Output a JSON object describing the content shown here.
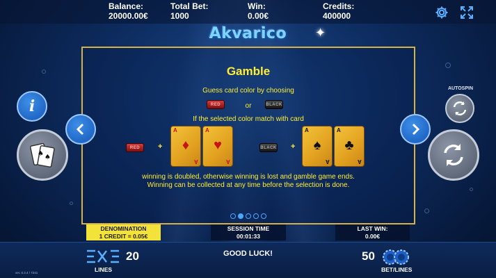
{
  "topbar": {
    "balance_label": "Balance:",
    "balance_value": "20000.00€",
    "total_bet_label": "Total Bet:",
    "total_bet_value": "1000",
    "win_label": "Win:",
    "win_value": "0.00€",
    "credits_label": "Credits:",
    "credits_value": "400000",
    "icons": [
      "gear-icon",
      "fullscreen-icon"
    ]
  },
  "logo": "Akvarico",
  "paytable": {
    "title": "Gamble",
    "instruction": "Guess card color by choosing",
    "or": "or",
    "match_text": "If the selected color match with card",
    "chip_red_text": "RED",
    "chip_black_text": "BLACK",
    "plus": "+",
    "red_cards": [
      {
        "rank": "A",
        "suit": "♦"
      },
      {
        "rank": "A",
        "suit": "♥"
      }
    ],
    "black_cards": [
      {
        "rank": "A",
        "suit": "♠"
      },
      {
        "rank": "A",
        "suit": "♣"
      }
    ],
    "result_line1": "winning is doubled, otherwise winning is lost and gamble game ends.",
    "result_line2": "Winning can be collected at any time before the selection is done.",
    "pages": 5,
    "active_page": 1
  },
  "buttons": {
    "info": "i",
    "autospin_label": "AUTOSPIN"
  },
  "info_strip": {
    "denomination_label": "DENOMINATION",
    "denomination_value": "1 CREDIT = 0.05€",
    "session_label": "SESSION TIME",
    "session_value": "00:01:33",
    "last_win_label": "LAST WIN:",
    "last_win_value": "0.00€"
  },
  "bottombar": {
    "lines_value": "20",
    "lines_label": "LINES",
    "message": "GOOD LUCK!",
    "bet_value": "50",
    "bet_label": "BET/LINES",
    "version": "ver. 0.3.4 / 7231"
  },
  "colors": {
    "accent_yellow": "#ffee33",
    "panel_border": "#d7b24a",
    "button_blue": "#1657b8"
  }
}
